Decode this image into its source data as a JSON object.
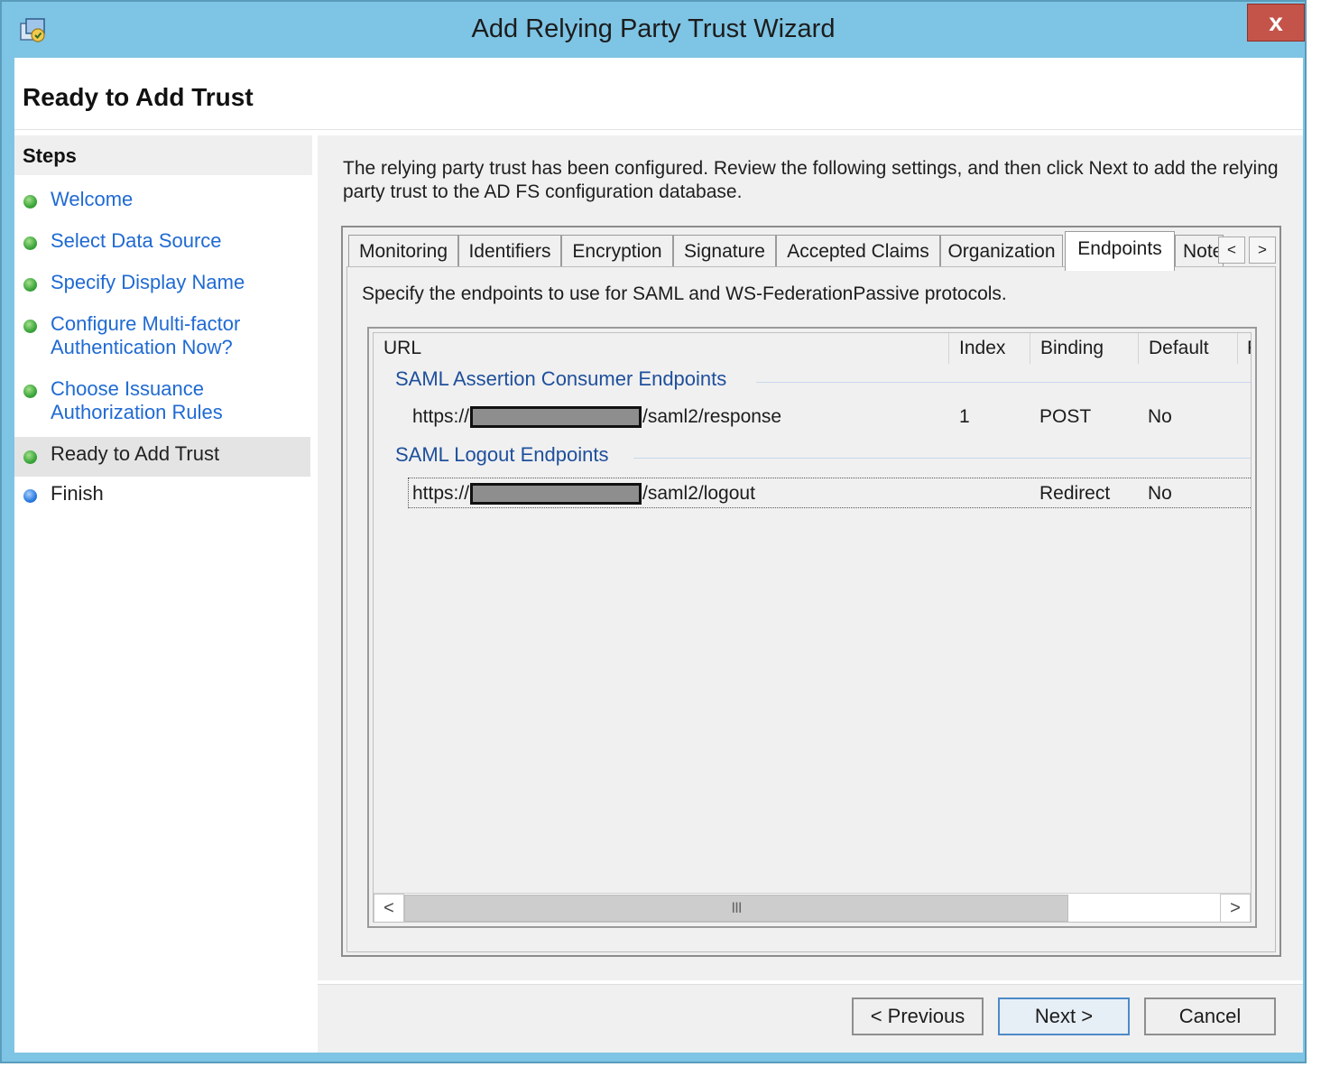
{
  "window": {
    "title": "Add Relying Party Trust Wizard",
    "close_glyph": "x"
  },
  "page_title": "Ready to Add Trust",
  "steps": {
    "header": "Steps",
    "items": [
      {
        "label": "Welcome",
        "status": "done"
      },
      {
        "label": "Select Data Source",
        "status": "done"
      },
      {
        "label": "Specify Display Name",
        "status": "done"
      },
      {
        "label": "Configure Multi-factor Authentication Now?",
        "line1": "Configure Multi-factor",
        "line2": "Authentication Now?",
        "status": "done"
      },
      {
        "label": "Choose Issuance Authorization Rules",
        "line1": "Choose Issuance",
        "line2": "Authorization Rules",
        "status": "done"
      },
      {
        "label": "Ready to Add Trust",
        "status": "current"
      },
      {
        "label": "Finish",
        "status": "pending"
      }
    ]
  },
  "intro_text": "The relying party trust has been configured. Review the following settings, and then click Next to add the relying party trust to the AD FS configuration database.",
  "tabs": {
    "items": [
      "Monitoring",
      "Identifiers",
      "Encryption",
      "Signature",
      "Accepted Claims",
      "Organization",
      "Endpoints",
      "Note"
    ],
    "active": "Endpoints",
    "prev_glyph": "<",
    "next_glyph": ">"
  },
  "endpoints": {
    "description": "Specify the endpoints to use for SAML and WS-FederationPassive protocols.",
    "columns": [
      "URL",
      "Index",
      "Binding",
      "Default",
      "F"
    ],
    "groups": [
      {
        "title": "SAML Assertion Consumer Endpoints",
        "rows": [
          {
            "url_prefix": "https://",
            "url_suffix": "/saml2/response",
            "index": "1",
            "binding": "POST",
            "default": "No"
          }
        ]
      },
      {
        "title": "SAML Logout Endpoints",
        "rows": [
          {
            "url_prefix": "https://",
            "url_suffix": "/saml2/logout",
            "index": "",
            "binding": "Redirect",
            "default": "No"
          }
        ]
      }
    ],
    "scroll_left_glyph": "<",
    "scroll_right_glyph": ">",
    "scroll_thumb_grip": "III"
  },
  "footer": {
    "previous_label": "< Previous",
    "next_label": "Next >",
    "cancel_label": "Cancel"
  },
  "colors": {
    "title_bar": "#7ec4e4",
    "close_button": "#c4544a",
    "link": "#1f6ad2",
    "group_header": "#1e4f9c",
    "step_done": "#3aa53a",
    "step_pending": "#2a7be0"
  }
}
